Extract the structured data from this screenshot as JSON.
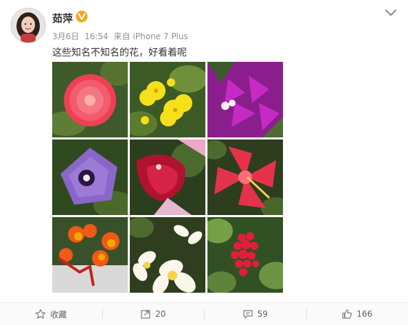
{
  "post": {
    "username": "茹萍",
    "meta": {
      "date": "3月6日",
      "time": "16:54",
      "source_prefix": "来自",
      "device": "iPhone 7 Plus"
    },
    "text": "这些知名不知名的花，好看着呢",
    "photos": [
      "red-pom-pom-flower",
      "yellow-flowers",
      "magenta-bougainvillea",
      "purple-morning-glory",
      "red-tropical-flower",
      "red-hibiscus",
      "orange-red-flowers",
      "white-frangipani",
      "red-ixora"
    ]
  },
  "actions": {
    "favorite_label": "收藏",
    "repost_count": "20",
    "comment_count": "59",
    "like_count": "166"
  },
  "colors": {
    "verified_badge": "#f5a623",
    "meta_text": "#8f8f8f"
  }
}
